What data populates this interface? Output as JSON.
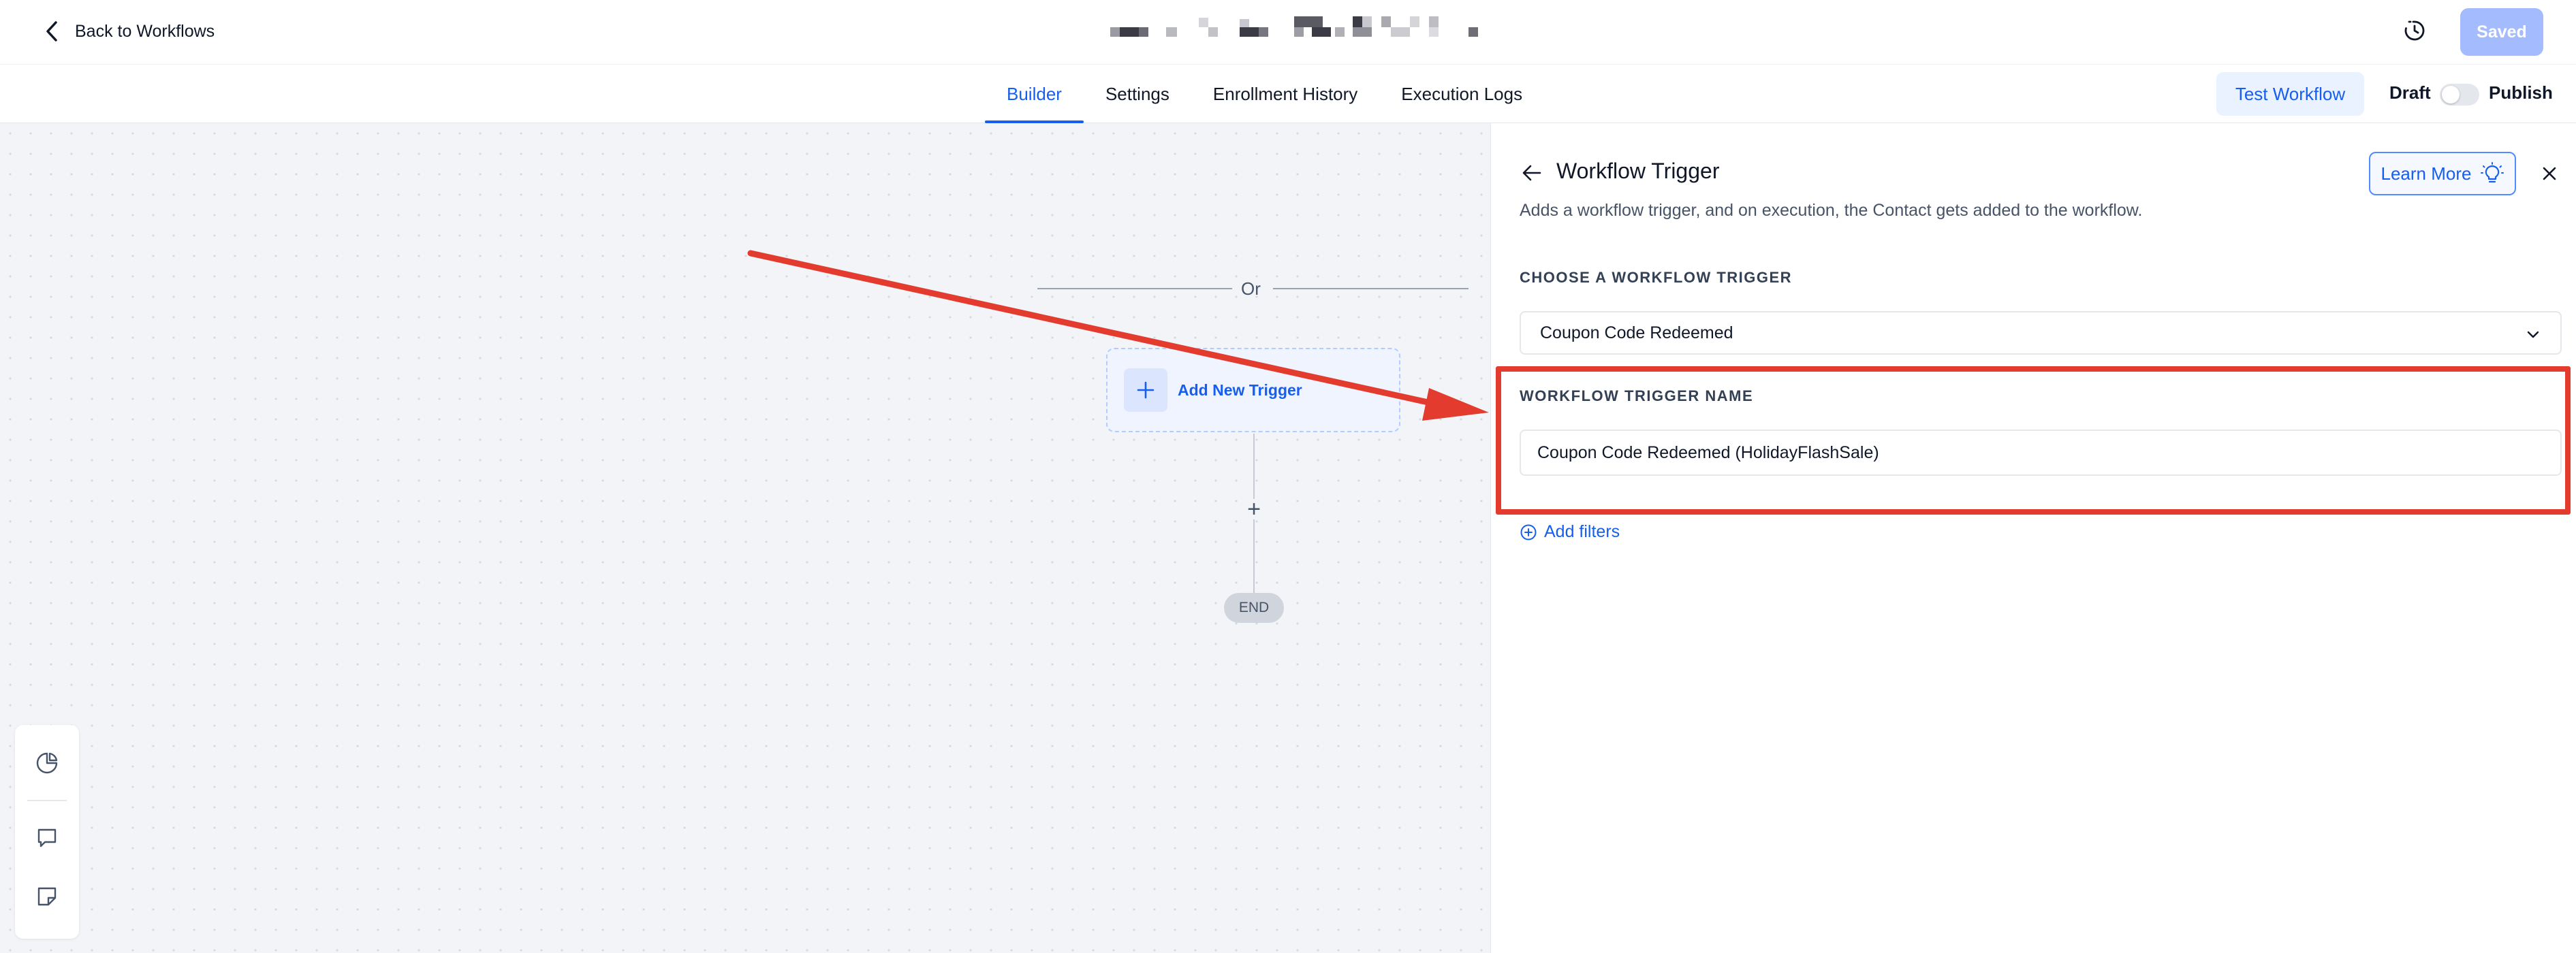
{
  "topbar": {
    "back_label": "Back to Workflows",
    "saved_label": "Saved"
  },
  "tabs": [
    {
      "label": "Builder",
      "active": true
    },
    {
      "label": "Settings",
      "active": false
    },
    {
      "label": "Enrollment History",
      "active": false
    },
    {
      "label": "Execution Logs",
      "active": false
    }
  ],
  "actions": {
    "test_workflow_label": "Test Workflow",
    "draft_label": "Draft",
    "publish_label": "Publish",
    "published": false
  },
  "canvas": {
    "or_label": "Or",
    "add_trigger_label": "Add New Trigger",
    "add_step_label": "+",
    "end_label": "END"
  },
  "panel": {
    "title": "Workflow Trigger",
    "learn_more_label": "Learn More",
    "description": "Adds a workflow trigger, and on execution, the Contact gets added to the workflow.",
    "choose_trigger_label": "CHOOSE A WORKFLOW TRIGGER",
    "selected_trigger": "Coupon Code Redeemed",
    "trigger_name_label": "WORKFLOW TRIGGER NAME",
    "trigger_name_value": "Coupon Code Redeemed (HolidayFlashSale)",
    "add_filters_label": "Add filters"
  },
  "colors": {
    "accent": "#155eef",
    "annotation_red": "#e43b2f",
    "saved_disabled": "#a4bcfd"
  }
}
